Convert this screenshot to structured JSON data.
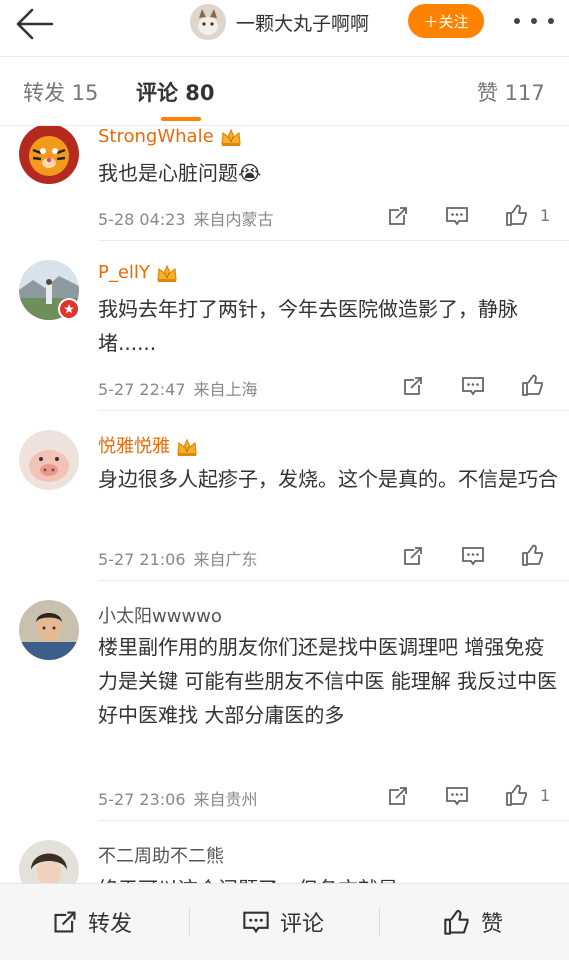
{
  "header": {
    "username": "一颗大丸子啊啊",
    "follow_label": "＋关注"
  },
  "tabs": {
    "repost": "转发 15",
    "comments": "评论 80",
    "likes": "赞 117"
  },
  "comments": [
    {
      "name": "StrongWhale",
      "text": "我也是心脏问题😭",
      "time": "5-28 04:23",
      "location": "来自内蒙古",
      "likes": "1"
    },
    {
      "name": "P_ellY",
      "text": "我妈去年打了两针，今年去医院做造影了，静脉堵......",
      "time": "5-27 22:47",
      "location": "来自上海",
      "likes": ""
    },
    {
      "name": "悦雅悦雅",
      "text": "身边很多人起疹子，发烧。这个是真的。不信是巧合",
      "time": "5-27 21:06",
      "location": "来自广东",
      "likes": ""
    },
    {
      "name": "小太阳wwwwo",
      "text": "楼里副作用的朋友你们还是找中医调理吧 增强免疫力是关键 可能有些朋友不信中医 能理解 我反过中医 好中医难找 大部分庸医的多",
      "time": "5-27 23:06",
      "location": "来自贵州",
      "likes": "1"
    },
    {
      "name": "不二周助不二熊",
      "text": "终于可以这个问题了，但各方就是...",
      "time": "",
      "location": "",
      "likes": ""
    }
  ],
  "bottom_bar": {
    "repost": "转发",
    "comment": "评论",
    "like": "赞"
  },
  "colors": {
    "accent": "#ff8200",
    "vip_name": "#e86b0a",
    "meta": "#888888"
  },
  "icons": [
    "back-arrow-icon",
    "more-icon",
    "crown-icon",
    "repost-icon",
    "comment-icon",
    "like-icon"
  ]
}
